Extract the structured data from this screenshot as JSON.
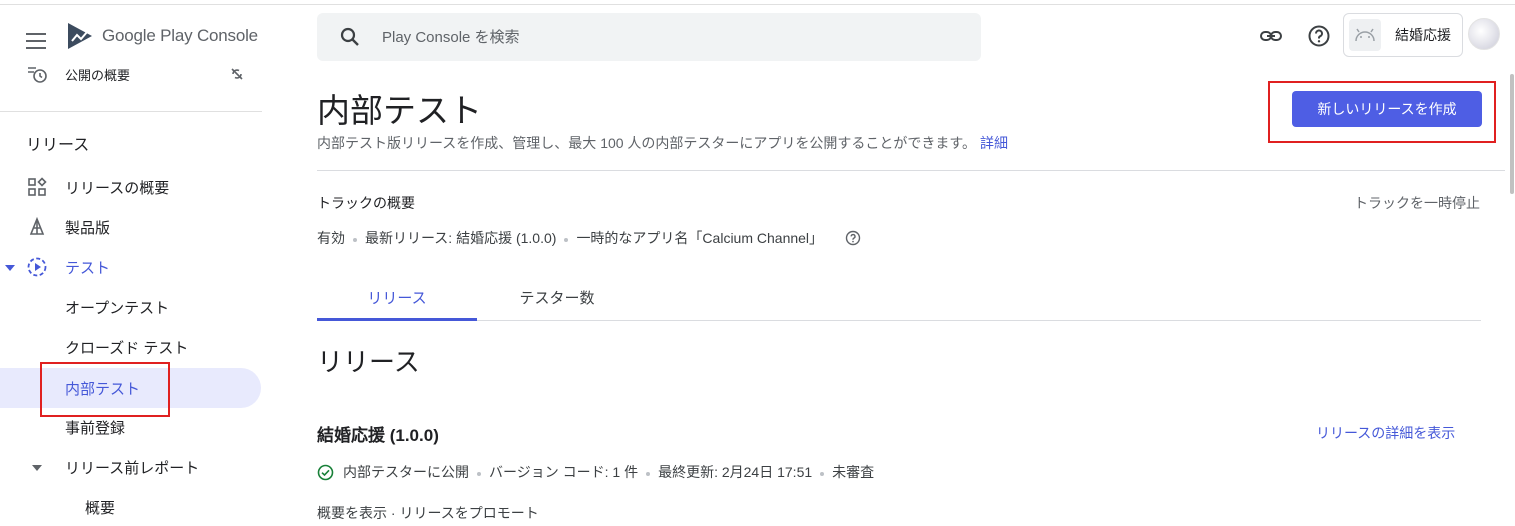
{
  "brand": {
    "google": "Google",
    "play": "Play",
    "console": "Console"
  },
  "sidebar": {
    "overview_item": "公開の概要",
    "section_release": "リリース",
    "items": [
      {
        "label": "リリースの概要",
        "icon": "dashboard-icon"
      },
      {
        "label": "製品版",
        "icon": "production-icon"
      },
      {
        "label": "テスト",
        "icon": "testing-icon"
      },
      {
        "label": "オープンテスト"
      },
      {
        "label": "クローズド テスト"
      },
      {
        "label": "内部テスト"
      },
      {
        "label": "事前登録"
      },
      {
        "label": "リリース前レポート"
      },
      {
        "label": "概要"
      }
    ]
  },
  "topbar": {
    "search_placeholder": "Play Console を検索",
    "app_name": "結婚応援"
  },
  "page": {
    "title": "内部テスト",
    "description": "内部テスト版リリースを作成、管理し、最大 100 人の内部テスターにアプリを公開することができます。",
    "details_link": "詳細",
    "create_button": "新しいリリースを作成"
  },
  "track": {
    "title": "トラックの概要",
    "pause": "トラックを一時停止",
    "status": "有効",
    "latest": "最新リリース: 結婚応援 (1.0.0)",
    "temp_name": "一時的なアプリ名「Calcium Channel」"
  },
  "tabs": [
    {
      "label": "リリース"
    },
    {
      "label": "テスター数"
    }
  ],
  "releases": {
    "heading": "リリース",
    "name": "結婚応援 (1.0.0)",
    "details_link": "リリースの詳細を表示",
    "status": "内部テスターに公開",
    "version": "バージョン コード: 1 件",
    "updated": "最終更新: 2月24日 17:51",
    "review": "未審査",
    "cut_row": "概要を表示 ·  リリースをプロモート"
  },
  "colors": {
    "accent": "#4e5ee4",
    "highlight": "#e8eafd",
    "annotation": "#e02020"
  }
}
